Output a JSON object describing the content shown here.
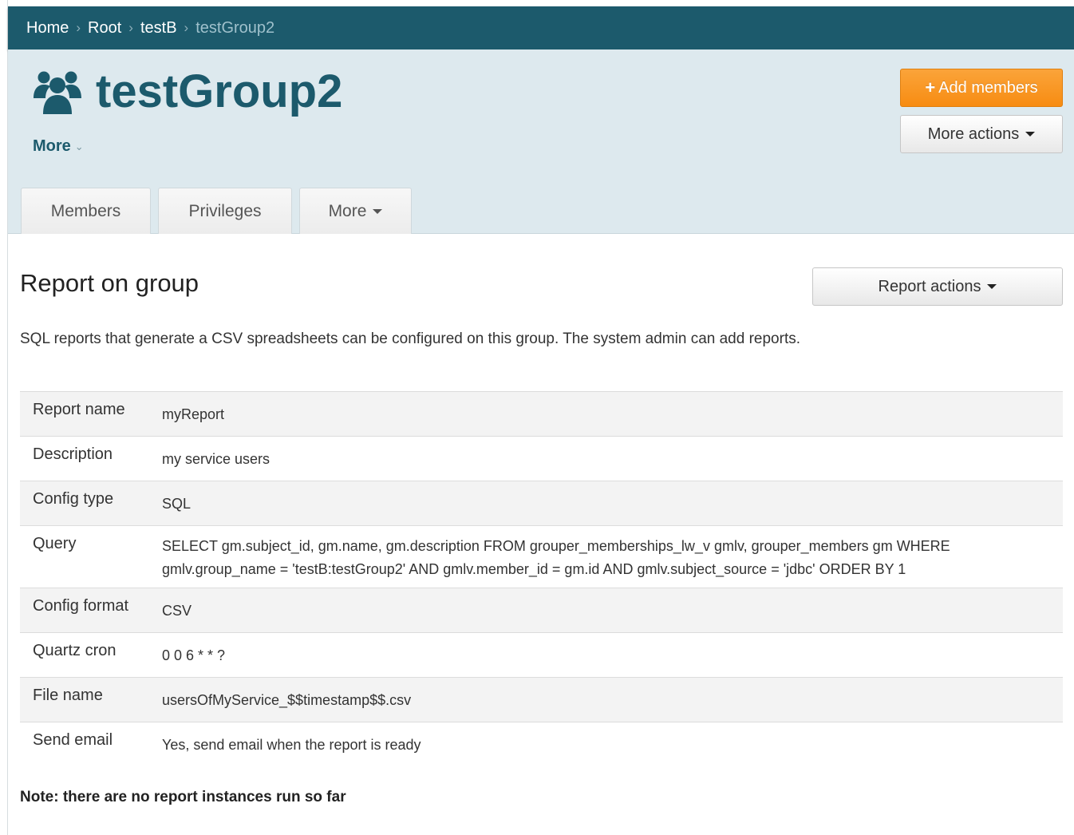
{
  "breadcrumb": {
    "items": [
      "Home",
      "Root",
      "testB"
    ],
    "current": "testGroup2",
    "separator": "›"
  },
  "header": {
    "group_name": "testGroup2",
    "group_icon": "users-icon",
    "more_label": "More",
    "add_members_label": "Add members",
    "more_actions_label": "More actions"
  },
  "tabs": [
    {
      "label": "Members"
    },
    {
      "label": "Privileges"
    },
    {
      "label": "More"
    }
  ],
  "report": {
    "title": "Report on group",
    "actions_label": "Report actions",
    "intro": "SQL reports that generate a CSV spreadsheets can be configured on this group. The system admin can add reports.",
    "rows": [
      {
        "label": "Report name",
        "value": "myReport"
      },
      {
        "label": "Description",
        "value": "my service users"
      },
      {
        "label": "Config type",
        "value": "SQL"
      },
      {
        "label": "Query",
        "value": "SELECT gm.subject_id, gm.name, gm.description FROM grouper_memberships_lw_v gmlv, grouper_members gm WHERE gmlv.group_name = 'testB:testGroup2' AND gmlv.member_id = gm.id AND gmlv.subject_source = 'jdbc' ORDER BY 1"
      },
      {
        "label": "Config format",
        "value": "CSV"
      },
      {
        "label": "Quartz cron",
        "value": "0 0 6 * * ?"
      },
      {
        "label": "File name",
        "value": "usersOfMyService_$$timestamp$$.csv"
      },
      {
        "label": "Send email",
        "value": "Yes, send email when the report is ready"
      }
    ],
    "note": "Note: there are no report instances run so far"
  },
  "colors": {
    "brand": "#1c5a6c",
    "header_bg": "#dde9ee",
    "accent_orange": "#f78c12"
  }
}
